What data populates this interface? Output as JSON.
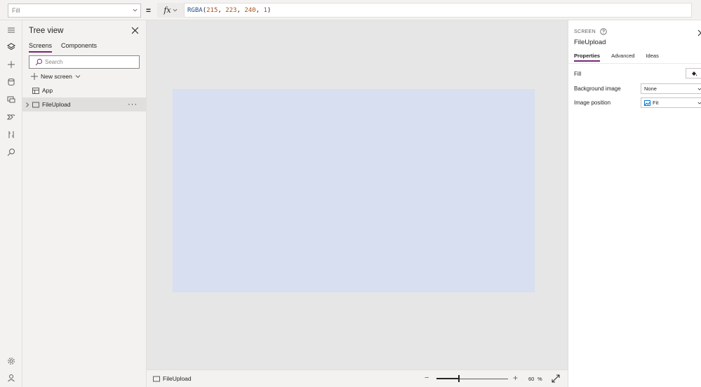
{
  "formula_bar": {
    "property": "Fill",
    "equals": "=",
    "fx_label": "fx",
    "formula_tokens": [
      {
        "t": "RGBA",
        "k": "fn"
      },
      {
        "t": "(",
        "k": "punc"
      },
      {
        "t": "215",
        "k": "num"
      },
      {
        "t": ", ",
        "k": "punc"
      },
      {
        "t": "223",
        "k": "num"
      },
      {
        "t": ", ",
        "k": "punc"
      },
      {
        "t": "240",
        "k": "num"
      },
      {
        "t": ", ",
        "k": "punc"
      },
      {
        "t": "1",
        "k": "num"
      },
      {
        "t": ")",
        "k": "punc"
      }
    ]
  },
  "rail": {
    "icons": [
      "hamburger-icon",
      "layers-icon",
      "insert-plus-icon",
      "data-cylinder-icon",
      "media-icon",
      "power-automate-icon",
      "variables-icon",
      "search-icon"
    ],
    "bottom_icons": [
      "settings-gear-icon",
      "virtual-agent-icon"
    ]
  },
  "tree": {
    "title": "Tree view",
    "tabs": [
      "Screens",
      "Components"
    ],
    "active_tab": "Screens",
    "search_placeholder": "Search",
    "new_screen_label": "New screen",
    "items": [
      {
        "label": "App",
        "icon": "app-icon",
        "selected": false
      },
      {
        "label": "FileUpload",
        "icon": "screen-icon",
        "selected": true,
        "more": "···"
      }
    ]
  },
  "canvas": {
    "background": "#e6e6e6",
    "screen_fill": "#d7dff0"
  },
  "bottom_bar": {
    "screen_label": "FileUpload",
    "zoom_minus": "−",
    "zoom_plus": "+",
    "zoom_value": "60",
    "zoom_unit": "%",
    "zoom_fraction": 0.3
  },
  "properties": {
    "kind": "SCREEN",
    "name": "FileUpload",
    "tabs": [
      "Properties",
      "Advanced",
      "Ideas"
    ],
    "active_tab": "Properties",
    "fill_label": "Fill",
    "background_image_label": "Background image",
    "background_image_value": "None",
    "image_position_label": "Image position",
    "image_position_value": "Fit"
  },
  "colors": {
    "accent": "#742774",
    "chrome": "#f3f2f1",
    "selection": "#e1dfdd"
  }
}
